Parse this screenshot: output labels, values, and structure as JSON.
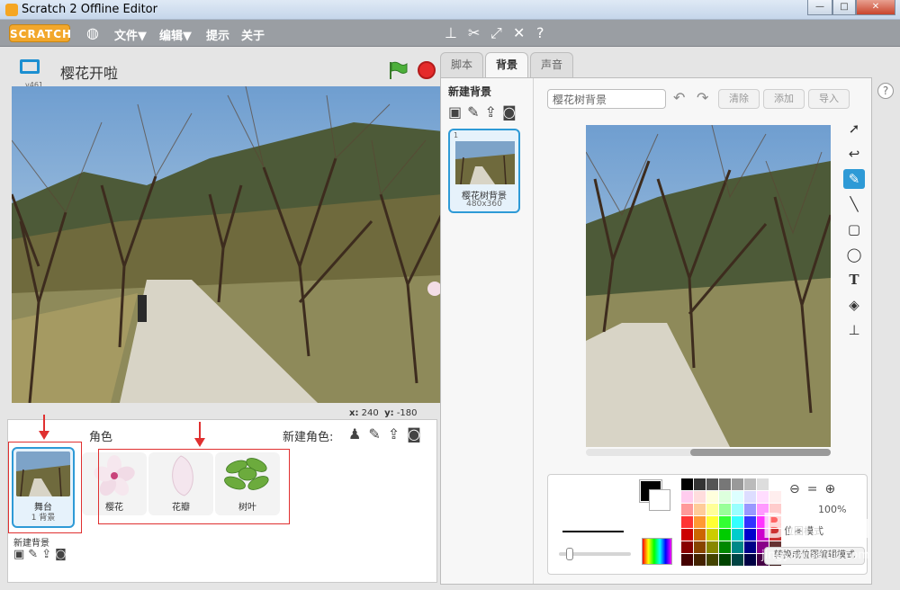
{
  "window": {
    "title": "Scratch 2 Offline Editor",
    "min": "—",
    "max": "□",
    "close": "✕"
  },
  "menu": {
    "logo": "SCRATCH",
    "file": "文件▼",
    "edit": "编辑▼",
    "tips": "提示",
    "about": "关于"
  },
  "stage": {
    "version": "v461",
    "name": "樱花开啦",
    "x_label": "x:",
    "x_value": "240",
    "y_label": "y:",
    "y_value": "-180"
  },
  "sprites_pane": {
    "title": "角色",
    "new_sprite": "新建角色:",
    "stage_label": "舞台",
    "stage_sub": "1 背景",
    "new_backdrop": "新建背景",
    "sprites": [
      {
        "name": "樱花"
      },
      {
        "name": "花瓣"
      },
      {
        "name": "树叶"
      }
    ]
  },
  "tabs": {
    "scripts": "脚本",
    "backdrops": "背景",
    "sounds": "声音"
  },
  "backdrops": {
    "header": "新建背景",
    "items": [
      {
        "num": "1",
        "name": "樱花树背景",
        "size": "480x360"
      }
    ]
  },
  "editor": {
    "name_value": "樱花树背景",
    "clear": "清除",
    "add": "添加",
    "import": "导入",
    "zoom": "100%",
    "convert": "转换成位图编辑模式",
    "mode": "位图模式"
  },
  "watermark": {
    "text": "Baidu",
    "sub": "jingyan.baidu.com"
  },
  "colors": {
    "accent": "#2e9ad6",
    "annotation": "#e03030",
    "menubar": "#9a9ea3"
  }
}
